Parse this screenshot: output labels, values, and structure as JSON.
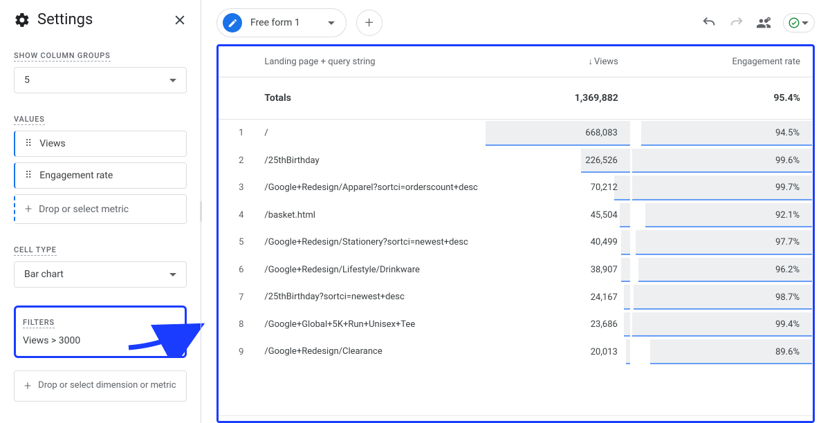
{
  "sidebar": {
    "title": "Settings",
    "show_column_groups": {
      "label": "SHOW COLUMN GROUPS",
      "value": "5"
    },
    "values": {
      "label": "VALUES",
      "items": [
        "Views",
        "Engagement rate"
      ],
      "drop": "Drop or select metric"
    },
    "cell_type": {
      "label": "CELL TYPE",
      "value": "Bar chart"
    },
    "filters": {
      "label": "FILTERS",
      "text": "Views > 3000"
    },
    "drop_dimension": "Drop or select dimension or metric"
  },
  "main": {
    "tab_label": "Free form 1",
    "columns": {
      "page": "Landing page + query string",
      "views": "Views",
      "engagement": "Engagement rate"
    },
    "totals_label": "Totals",
    "totals": {
      "views": "1,369,882",
      "engagement": "95.4%"
    },
    "rows": [
      {
        "idx": "1",
        "page": "/",
        "views": "668,083",
        "eng": "94.5%",
        "vw": 100,
        "ew": 94.5
      },
      {
        "idx": "2",
        "page": "/25thBirthday",
        "views": "226,526",
        "eng": "99.6%",
        "vw": 34,
        "ew": 99.6
      },
      {
        "idx": "3",
        "page": "/Google+Redesign/Apparel?sortci=orderscount+desc",
        "views": "70,212",
        "eng": "99.7%",
        "vw": 11,
        "ew": 99.7
      },
      {
        "idx": "4",
        "page": "/basket.html",
        "views": "45,504",
        "eng": "92.1%",
        "vw": 7,
        "ew": 92.1
      },
      {
        "idx": "5",
        "page": "/Google+Redesign/Stationery?sortci=newest+desc",
        "views": "40,499",
        "eng": "97.7%",
        "vw": 6,
        "ew": 97.7
      },
      {
        "idx": "6",
        "page": "/Google+Redesign/Lifestyle/Drinkware",
        "views": "38,907",
        "eng": "96.2%",
        "vw": 6,
        "ew": 96.2
      },
      {
        "idx": "7",
        "page": "/25thBirthday?sortci=newest+desc",
        "views": "24,167",
        "eng": "98.7%",
        "vw": 4,
        "ew": 98.7
      },
      {
        "idx": "8",
        "page": "/Google+Global+5K+Run+Unisex+Tee",
        "views": "23,686",
        "eng": "99.4%",
        "vw": 4,
        "ew": 99.4
      },
      {
        "idx": "9",
        "page": "/Google+Redesign/Clearance",
        "views": "20,013",
        "eng": "89.6%",
        "vw": 3,
        "ew": 89.6
      }
    ]
  },
  "chart_data": {
    "type": "table",
    "title": "Free form 1",
    "columns": [
      "Landing page + query string",
      "Views",
      "Engagement rate"
    ],
    "totals": {
      "Views": 1369882,
      "Engagement rate": 95.4
    },
    "rows": [
      {
        "Landing page + query string": "/",
        "Views": 668083,
        "Engagement rate": 94.5
      },
      {
        "Landing page + query string": "/25thBirthday",
        "Views": 226526,
        "Engagement rate": 99.6
      },
      {
        "Landing page + query string": "/Google+Redesign/Apparel?sortci=orderscount+desc",
        "Views": 70212,
        "Engagement rate": 99.7
      },
      {
        "Landing page + query string": "/basket.html",
        "Views": 45504,
        "Engagement rate": 92.1
      },
      {
        "Landing page + query string": "/Google+Redesign/Stationery?sortci=newest+desc",
        "Views": 40499,
        "Engagement rate": 97.7
      },
      {
        "Landing page + query string": "/Google+Redesign/Lifestyle/Drinkware",
        "Views": 38907,
        "Engagement rate": 96.2
      },
      {
        "Landing page + query string": "/25thBirthday?sortci=newest+desc",
        "Views": 24167,
        "Engagement rate": 98.7
      },
      {
        "Landing page + query string": "/Google+Global+5K+Run+Unisex+Tee",
        "Views": 23686,
        "Engagement rate": 99.4
      },
      {
        "Landing page + query string": "/Google+Redesign/Clearance",
        "Views": 20013,
        "Engagement rate": 89.6
      }
    ]
  }
}
